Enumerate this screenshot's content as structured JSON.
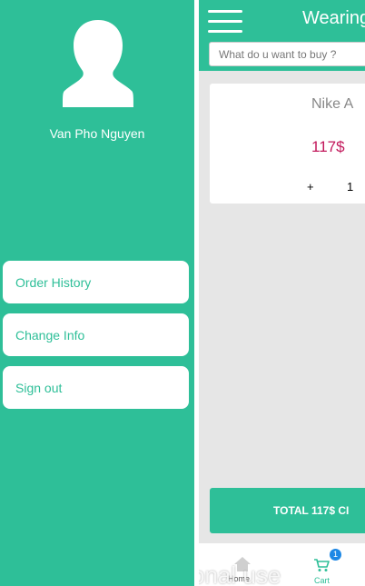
{
  "drawer": {
    "user_name": "Van Pho Nguyen",
    "avatar_icon": "user-silhouette-icon",
    "menu": [
      {
        "label": "Order History"
      },
      {
        "label": "Change Info"
      },
      {
        "label": "Sign out"
      }
    ]
  },
  "app": {
    "title": "Wearing",
    "search_placeholder": "What do u want to buy ?",
    "product": {
      "name": "Nike A",
      "price": "117$",
      "qty_plus": "+",
      "qty_value": "1"
    },
    "total_label": "TOTAL 117$ CI",
    "nav": {
      "home_label": "Home",
      "cart_label": "Cart",
      "cart_badge": "1"
    },
    "watermark": "onal use"
  },
  "colors": {
    "accent": "#2ebf98",
    "price": "#c2185b",
    "badge": "#1e88e5"
  }
}
